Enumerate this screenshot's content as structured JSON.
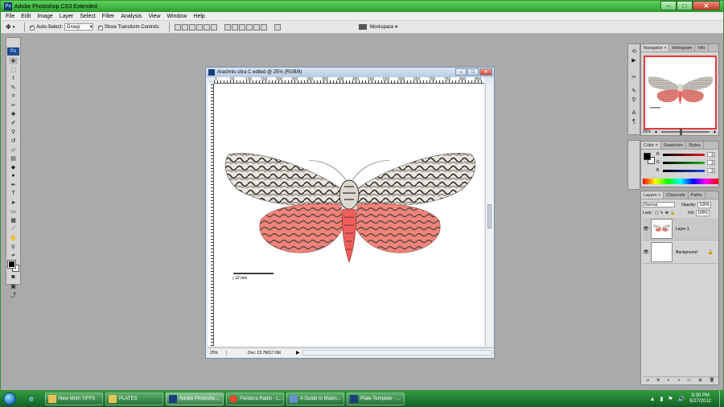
{
  "window": {
    "title": "Adobe Photoshop CS3 Extended",
    "app_icon": "Ps",
    "controls": {
      "minimize": "–",
      "maximize": "□",
      "close": "✕"
    }
  },
  "menu": [
    "File",
    "Edit",
    "Image",
    "Layer",
    "Select",
    "Filter",
    "Analysis",
    "View",
    "Window",
    "Help"
  ],
  "options_bar": {
    "auto_select_label": "Auto-Select:",
    "auto_select_value": "Group",
    "show_transform_label": "Show Transform Controls",
    "workspace_label": "Workspace ▾"
  },
  "tools_logo": "Ps",
  "document": {
    "title": "Arachnis citra C edited @ 25% (RGB/8)",
    "ruler_ticks": [
      "0",
      "50",
      "100",
      "150",
      "200",
      "250",
      "300",
      "350",
      "400",
      "450",
      "500",
      "550",
      "600",
      "650",
      "700",
      "750",
      "800",
      "850"
    ],
    "scale_label": "10 mm",
    "status_zoom": "25%",
    "status_info": "Doc: 23.7M/17.6M"
  },
  "navigator": {
    "tabs": [
      "Navigator ×",
      "Histogram",
      "Info"
    ],
    "zoom": "25%"
  },
  "color_panel": {
    "tabs": [
      "Color ×",
      "Swatches",
      "Styles"
    ],
    "channels": [
      {
        "label": "R",
        "value": "3",
        "color": "#e02020"
      },
      {
        "label": "G",
        "value": "3",
        "color": "#20b020"
      },
      {
        "label": "B",
        "value": "3",
        "color": "#2040e0"
      }
    ]
  },
  "layers_panel": {
    "tabs": [
      "Layers ×",
      "Channels",
      "Paths"
    ],
    "blend_mode": "Normal",
    "opacity_label": "Opacity:",
    "opacity_value": "100%",
    "lock_label": "Lock:",
    "fill_label": "Fill:",
    "fill_value": "100%",
    "layers": [
      {
        "name": "Layer 1",
        "active": true
      },
      {
        "name": "Background",
        "active": false
      }
    ],
    "footer_icons": [
      "∞",
      "fx",
      "◐",
      "◑",
      "▭",
      "⊞",
      "🗑"
    ]
  },
  "taskbar": {
    "items": [
      {
        "label": "New Moth TIFFS",
        "icon_color": "#e8c25a"
      },
      {
        "label": "PLATES",
        "icon_color": "#e8c25a"
      },
      {
        "label": "Adobe Photosho...",
        "icon_color": "#1b3e7c",
        "active": true
      },
      {
        "label": "Pandora Radio - L...",
        "icon_color": "#e44a2f"
      },
      {
        "label": "A Guide to Makin...",
        "icon_color": "#6a8fd0"
      },
      {
        "label": "Plate Template - ...",
        "icon_color": "#1b3e7c"
      }
    ],
    "time": "9:39 PM",
    "date": "6/27/2012"
  }
}
